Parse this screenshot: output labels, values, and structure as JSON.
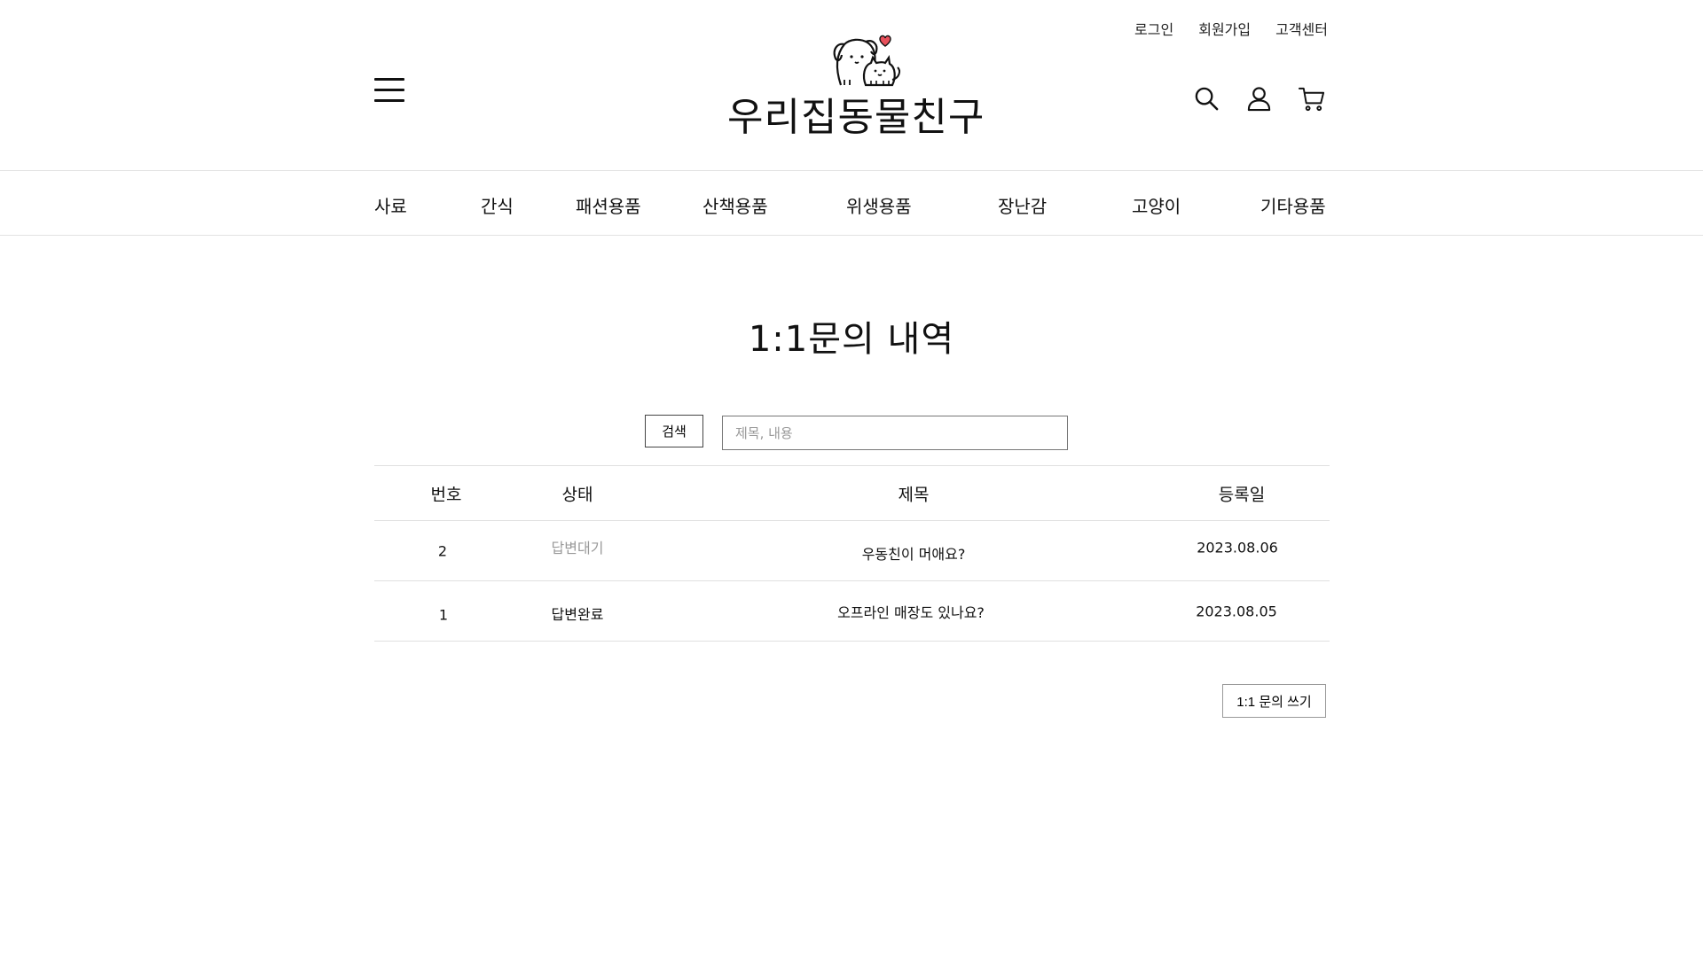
{
  "header": {
    "top_links": [
      "로그인",
      "회원가입",
      "고객센터"
    ],
    "logo_text": "우리집동물친구",
    "logo_heart_color": "#e8505b",
    "icons": [
      "search-icon",
      "user-icon",
      "cart-icon"
    ]
  },
  "nav": {
    "items": [
      "사료",
      "간식",
      "패션용품",
      "산책용품",
      "위생용품",
      "장난감",
      "고양이",
      "기타용품"
    ]
  },
  "main": {
    "title": "1:1문의 내역",
    "search": {
      "button_label": "검색",
      "placeholder": "제목, 내용",
      "value": ""
    },
    "table": {
      "columns": [
        "번호",
        "상태",
        "제목",
        "등록일"
      ],
      "rows": [
        {
          "no": "2",
          "status": "답변대기",
          "title": "우동친이 머애요?",
          "date": "2023.08.06"
        },
        {
          "no": "1",
          "status": "답변완료",
          "title": "오프라인 매장도 있나요?",
          "date": "2023.08.05"
        }
      ],
      "status_colors": {
        "pending": "#999999",
        "done": "#111111"
      }
    },
    "write_button_label": "1:1 문의 쓰기"
  }
}
